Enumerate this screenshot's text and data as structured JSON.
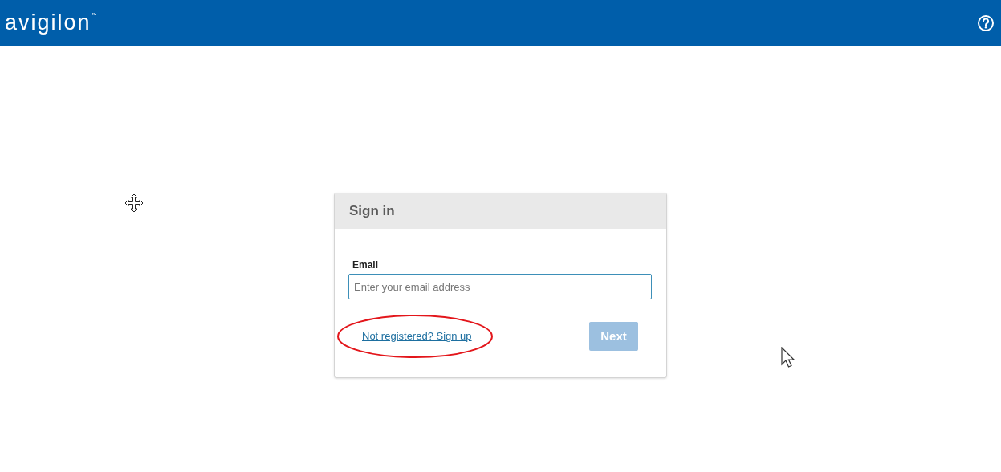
{
  "header": {
    "logo": "avigilon",
    "logo_mark": "™"
  },
  "sign_in": {
    "title": "Sign in",
    "email_label": "Email",
    "email_placeholder": "Enter your email address",
    "signup_link": "Not registered? Sign up",
    "next_button": {
      "label": "Next",
      "disabled": true
    }
  }
}
